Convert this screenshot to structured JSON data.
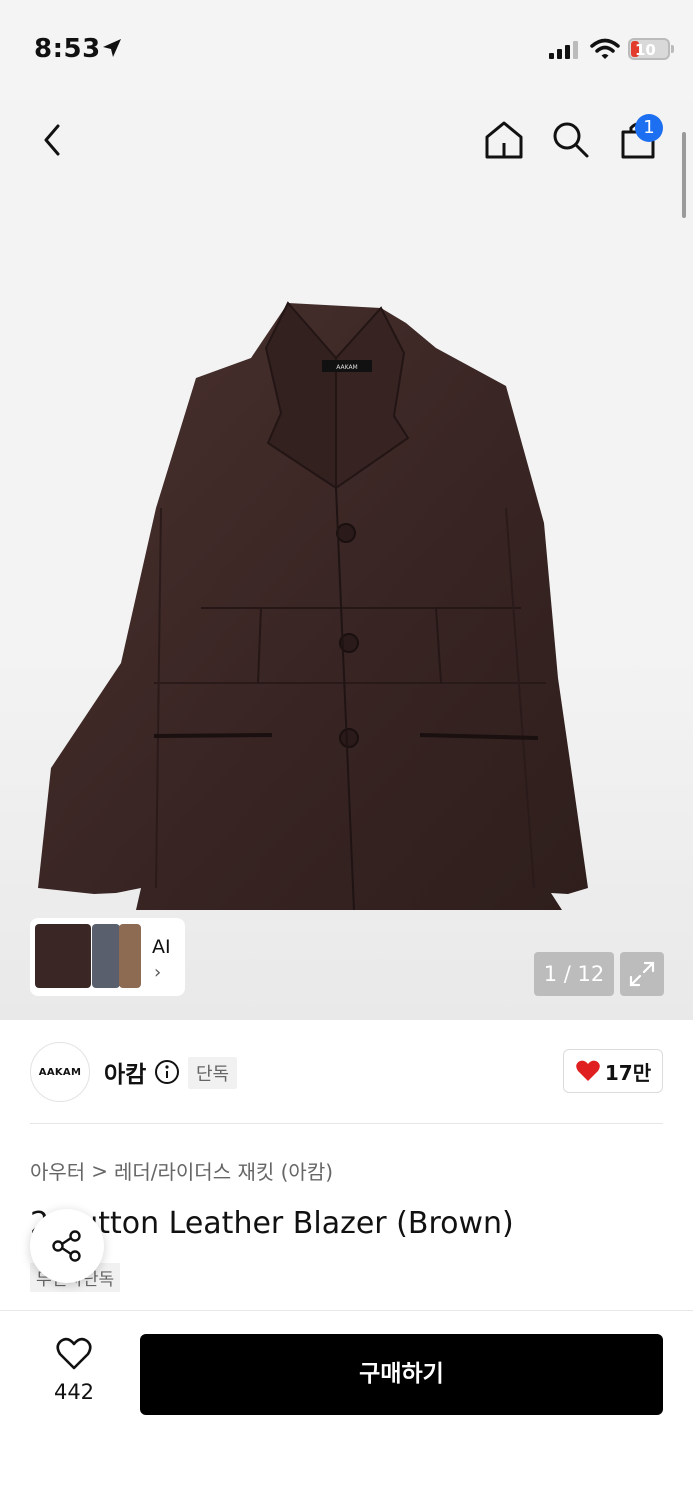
{
  "status_bar": {
    "time": "8:53",
    "battery": "10"
  },
  "nav": {
    "cart_count": "1"
  },
  "gallery": {
    "page_counter": "1 / 12",
    "ai_label": "AI",
    "ai_chevron": "›",
    "garment_label": "AAKAM"
  },
  "brand": {
    "logo_text": "AAKAM",
    "name": "아캄",
    "exclusive": "단독",
    "likes": "17만"
  },
  "breadcrumb": {
    "category": "아우터",
    "separator": ">",
    "subcategory": "레더/라이더스 재킷 (아캄)"
  },
  "product": {
    "title": "2 Button Leather Blazer (Brown)",
    "tag": "무신사단독"
  },
  "bottom_bar": {
    "wish_count": "442",
    "buy_label": "구매하기"
  },
  "colors": {
    "accent_blue": "#1d6ff2",
    "heart_red": "#e02020",
    "jacket_brown": "#3a2624",
    "buy_button": "#000000"
  }
}
